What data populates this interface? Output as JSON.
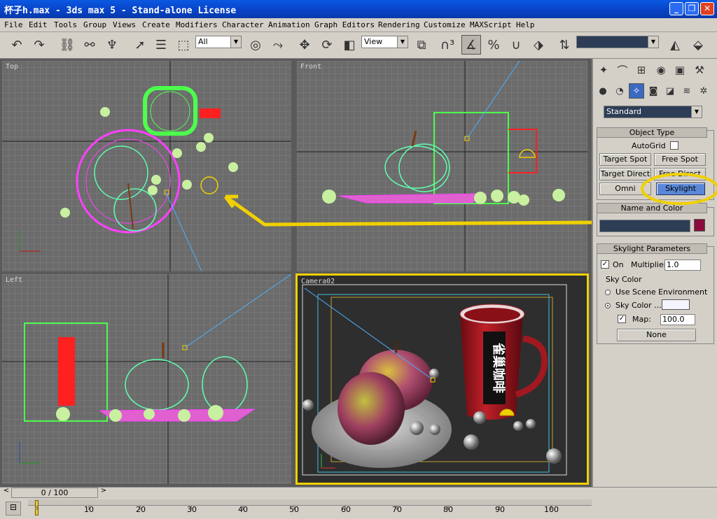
{
  "window": {
    "title": "杯子h.max - 3ds max 5 - Stand-alone License",
    "controls": [
      "_",
      "❐",
      "✕"
    ]
  },
  "menu": [
    "File",
    "Edit",
    "Tools",
    "Group",
    "Views",
    "Create",
    "Modifiers",
    "Character",
    "Animation",
    "Graph Editors",
    "Rendering",
    "Customize",
    "MAXScript",
    "Help"
  ],
  "toolbar": {
    "selection_filter": "All",
    "reference_coord": "View",
    "named_selection": ""
  },
  "viewports": {
    "top_label": "Top",
    "front_label": "Front",
    "left_label": "Left",
    "camera_label": "Camera02",
    "mug_text": "雀巢咖啡"
  },
  "command_panel": {
    "dropdown": "Standard",
    "object_type": {
      "title": "Object Type",
      "autogrid": "AutoGrid",
      "buttons": [
        "Target Spot",
        "Free Spot",
        "Target Direct",
        "Free Direct",
        "Omni",
        "Skylight"
      ]
    },
    "name_color": {
      "title": "Name and Color",
      "name_value": "",
      "swatch_color": "#8a0c3c"
    },
    "skylight_params": {
      "title": "Skylight Parameters",
      "on_label": "On",
      "multiplier_label": "Multiplier:",
      "multiplier_value": "1.0",
      "sky_color_label": "Sky Color",
      "use_scene_env": "Use Scene Environment",
      "sky_color_option": "Sky Color ...",
      "map_label": "Map:",
      "map_value": "100.0",
      "map_button": "None"
    }
  },
  "timeline": {
    "frame_display": "0 / 100",
    "ticks": [
      "10",
      "20",
      "30",
      "40",
      "50",
      "60",
      "70",
      "80",
      "90",
      "100"
    ]
  },
  "colors": {
    "annotation": "#f0d000",
    "wire_green": "#4cff4c",
    "wire_pink": "#ff40ff",
    "wire_mint": "#60ffb0"
  }
}
